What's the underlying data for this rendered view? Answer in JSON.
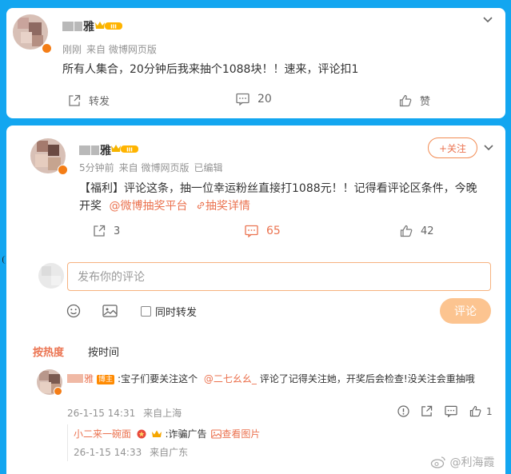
{
  "post": {
    "author": "雅",
    "time": "刚刚",
    "source": "来自 微博网页版",
    "text": "所有人集合，20分钟后我来抽个1088块！！速来，评论扣1",
    "repost_label": "转发",
    "comment_count": "20",
    "like_label": "赞"
  },
  "post2": {
    "author": "雅",
    "time": "5分钟前",
    "source": "来自 微博网页版",
    "edited": "已编辑",
    "follow_label": "+关注",
    "text_line1": "【福利】评论这条，抽一位幸运粉丝直接打1088元！！记得看评论区条件，今晚",
    "text_line2_prefix": "开奖",
    "mention_link": "@微博抽奖平台",
    "detail_link": "抽奖详情",
    "repost_count": "3",
    "comment_count": "65",
    "like_count": "42"
  },
  "composer": {
    "placeholder": "发布你的评论",
    "repost_checkbox_label": "同时转发",
    "submit_label": "评论"
  },
  "sort_tabs": {
    "hot": "按热度",
    "time": "按时间"
  },
  "comment": {
    "author": "雅",
    "badge": "博主",
    "text_prefix": ":宝子们要关注这个",
    "mention": "@二七幺幺_",
    "text_suffix": "评论了记得关注她，开奖后会检查!没关注会重抽哦",
    "time": "26-1-15 14:31",
    "location": "来自上海",
    "like_count": "1"
  },
  "reply": {
    "author": "小二来一碗面",
    "text": ":诈骗广告",
    "view_image": "查看图片",
    "time": "26-1-15 14:33",
    "location": "来自广东"
  },
  "watermark": "@利海霞",
  "colors": {
    "background": "#13a6f0",
    "accent": "#eb7350",
    "submit_disabled": "#fcc490"
  }
}
